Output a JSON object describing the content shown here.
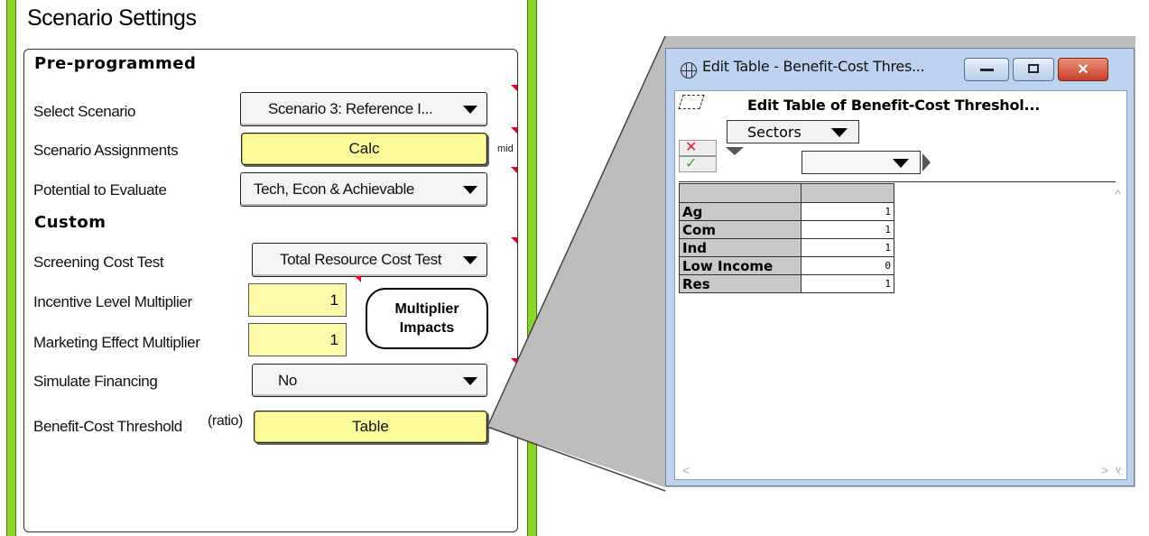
{
  "panel": {
    "title": "Scenario Settings",
    "preprogrammed_header": "Pre-programmed",
    "custom_header": "Custom",
    "select_scenario": {
      "label": "Select Scenario",
      "value": "Scenario 3: Reference I..."
    },
    "scenario_assignments": {
      "label": "Scenario Assignments",
      "button": "Calc",
      "note": "mid"
    },
    "potential": {
      "label": "Potential to Evaluate",
      "value": "Tech, Econ & Achievable"
    },
    "screening": {
      "label": "Screening Cost Test",
      "value": "Total Resource Cost Test"
    },
    "incentive": {
      "label": "Incentive Level Multiplier",
      "value": "1"
    },
    "marketing": {
      "label": "Marketing Effect Multiplier",
      "value": "1"
    },
    "multiplier_button": {
      "line1": "Multiplier",
      "line2": "Impacts"
    },
    "financing": {
      "label": "Simulate Financing",
      "value": "No"
    },
    "benefit_cost": {
      "label": "Benefit-Cost Threshold",
      "unit": "(ratio)",
      "button": "Table"
    }
  },
  "window": {
    "title": "Edit Table - Benefit-Cost Thres...",
    "heading": "Edit Table of Benefit-Cost Threshol...",
    "index_dropdown": "Sectors",
    "rows": [
      {
        "label": "Ag",
        "value": "1"
      },
      {
        "label": "Com",
        "value": "1"
      },
      {
        "label": "Ind",
        "value": "1"
      },
      {
        "label": "Low Income",
        "value": "0"
      },
      {
        "label": "Res",
        "value": "1"
      }
    ]
  },
  "colors": {
    "frame_green": "#8bd42a",
    "button_yellow": "#fdfa9a",
    "marker_red": "#e8001c",
    "window_blue": "#bcd2ee"
  }
}
